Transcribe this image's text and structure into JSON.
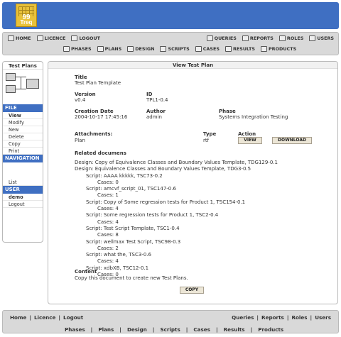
{
  "logo": {
    "number": "99",
    "text": "Treq"
  },
  "nav": {
    "row1_left": [
      {
        "label": "Home",
        "icon": "home-icon"
      },
      {
        "label": "Licence",
        "icon": "licence-icon"
      },
      {
        "label": "Logout",
        "icon": "logout-icon"
      }
    ],
    "row1_right": [
      {
        "label": "Queries",
        "icon": "search-icon"
      },
      {
        "label": "Reports",
        "icon": "reports-icon"
      },
      {
        "label": "Roles",
        "icon": "roles-icon"
      },
      {
        "label": "Users",
        "icon": "users-icon"
      }
    ],
    "row2": [
      {
        "label": "Phases",
        "icon": "phases-icon"
      },
      {
        "label": "Plans",
        "icon": "plans-icon"
      },
      {
        "label": "Design",
        "icon": "design-icon"
      },
      {
        "label": "Scripts",
        "icon": "scripts-icon"
      },
      {
        "label": "Cases",
        "icon": "cases-icon"
      },
      {
        "label": "Results",
        "icon": "results-icon"
      },
      {
        "label": "Products",
        "icon": "products-icon"
      }
    ]
  },
  "sidebar": {
    "title": "Test Plans",
    "file_header": "FILE",
    "file_items": [
      "View",
      "Modify",
      "New",
      "Delete",
      "Copy",
      "Print"
    ],
    "navigation_header": "NAVIGATION",
    "list_item": "List",
    "user_header": "USER",
    "user_name": "demo",
    "logout": "Logout"
  },
  "main": {
    "title": "View Test Plan",
    "title_label": "Title",
    "title_value": "Test Plan Template",
    "version_label": "Version",
    "version_value": "v0.4",
    "id_label": "ID",
    "id_value": "TPL1-0.4",
    "creation_label": "Creation Date",
    "creation_value": "2004-10-17 17:45:16",
    "author_label": "Author",
    "author_value": "admin",
    "phase_label": "Phase",
    "phase_value": "Systems Integration Testing",
    "attachments_label": "Attachments:",
    "attachment_name": "Plan",
    "type_label": "Type",
    "type_value": "rtf",
    "action_label": "Action",
    "view_button": "VIEW",
    "download_button": "DOWNLOAD",
    "related_label": "Related documens",
    "related": [
      "Design: Copy of Equivalence Classes and Boundary Values Template, TDG129-0.1",
      "Design: Equivalence Classes and Boundary Values Template, TDG3-0.5",
      "Script: AAAA kkkkk, TSC73-0.2",
      "Cases: 0",
      "Script: amcvf_script_01, TSC147-0.6",
      "Cases: 1",
      "Script: Copy of Some regression tests for Product 1, TSC154-0.1",
      "Cases: 4",
      "Script: Some regression tests for Product 1, TSC2-0.4",
      "Cases: 4",
      "Script: Test Script Template, TSC1-0.4",
      "Cases: 8",
      "Script: wellmax Test Script, TSC98-0.3",
      "Cases: 2",
      "Script: what the, TSC3-0.6",
      "Cases: 4",
      "Script: xdbXB, TSC12-0.1",
      "Cases: 0"
    ],
    "content_label": "Content",
    "content_value": "Copy this document to create new Test Plans.",
    "copy_button": "COPY"
  },
  "footer": {
    "left": [
      "Home",
      "Licence",
      "Logout"
    ],
    "right": [
      "Queries",
      "Reports",
      "Roles",
      "Users"
    ],
    "bottom": [
      "Phases",
      "Plans",
      "Design",
      "Scripts",
      "Cases",
      "Results",
      "Products"
    ]
  }
}
